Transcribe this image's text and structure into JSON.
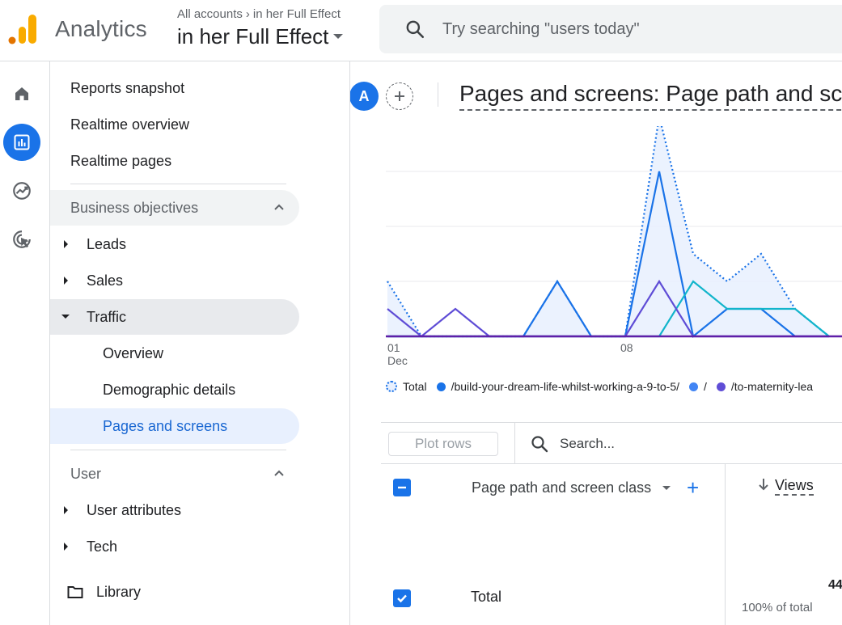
{
  "header": {
    "app_name": "Analytics",
    "breadcrumb_all": "All accounts",
    "breadcrumb_account": "in her Full Effect",
    "property_name": "in her Full Effect",
    "search_placeholder": "Try searching \"users today\""
  },
  "nav": {
    "items": [
      {
        "label": "Reports snapshot"
      },
      {
        "label": "Realtime overview"
      },
      {
        "label": "Realtime pages"
      }
    ],
    "section_business": "Business objectives",
    "business_items": [
      {
        "label": "Leads"
      },
      {
        "label": "Sales"
      },
      {
        "label": "Traffic"
      }
    ],
    "traffic_children": [
      {
        "label": "Overview"
      },
      {
        "label": "Demographic details"
      },
      {
        "label": "Pages and screens"
      }
    ],
    "section_user": "User",
    "user_items": [
      {
        "label": "User attributes"
      },
      {
        "label": "Tech"
      }
    ],
    "library": "Library"
  },
  "report": {
    "avatar_letter": "A",
    "title": "Pages and screens: Page path and screen class"
  },
  "chart_data": {
    "type": "line",
    "x_tick_labels": [
      "01 Dec",
      "08"
    ],
    "x": [
      1,
      2,
      3,
      4,
      5,
      6,
      7,
      8,
      9,
      10,
      11,
      12,
      13,
      14
    ],
    "series": [
      {
        "name": "Total",
        "color": "#1a73e8",
        "style": "dotted-area",
        "values": [
          1,
          0,
          0,
          0,
          0,
          1,
          0,
          0,
          4,
          1.5,
          1,
          1.5,
          0.5,
          0
        ]
      },
      {
        "name": "/build-your-dream-life-whilst-working-a-9-to-5/",
        "color": "#1a73e8",
        "values": [
          0,
          0,
          0,
          0,
          0,
          1,
          0,
          0,
          3,
          0,
          0.5,
          0.5,
          0,
          0
        ]
      },
      {
        "name": "/",
        "color": "#12b5cb",
        "values": [
          0,
          0,
          0,
          0,
          0,
          0,
          0,
          0,
          0,
          1,
          0.5,
          0.5,
          0.5,
          0
        ]
      },
      {
        "name": "/to-maternity-leave",
        "color": "#5f4dd6",
        "values": [
          0.5,
          0,
          0.5,
          0,
          0,
          0,
          0,
          0,
          1,
          0,
          0,
          0,
          0,
          0
        ]
      }
    ],
    "legend_labels": [
      "Total",
      "/build-your-dream-life-whilst-working-a-9-to-5/",
      "/",
      "/to-maternity-lea"
    ],
    "grid": true
  },
  "table": {
    "plot_rows_label": "Plot rows",
    "search_placeholder": "Search...",
    "dimension_header": "Page path and screen class",
    "metric_header": "Views",
    "total_label": "Total",
    "total_views": "44",
    "total_pct": "100% of total"
  }
}
